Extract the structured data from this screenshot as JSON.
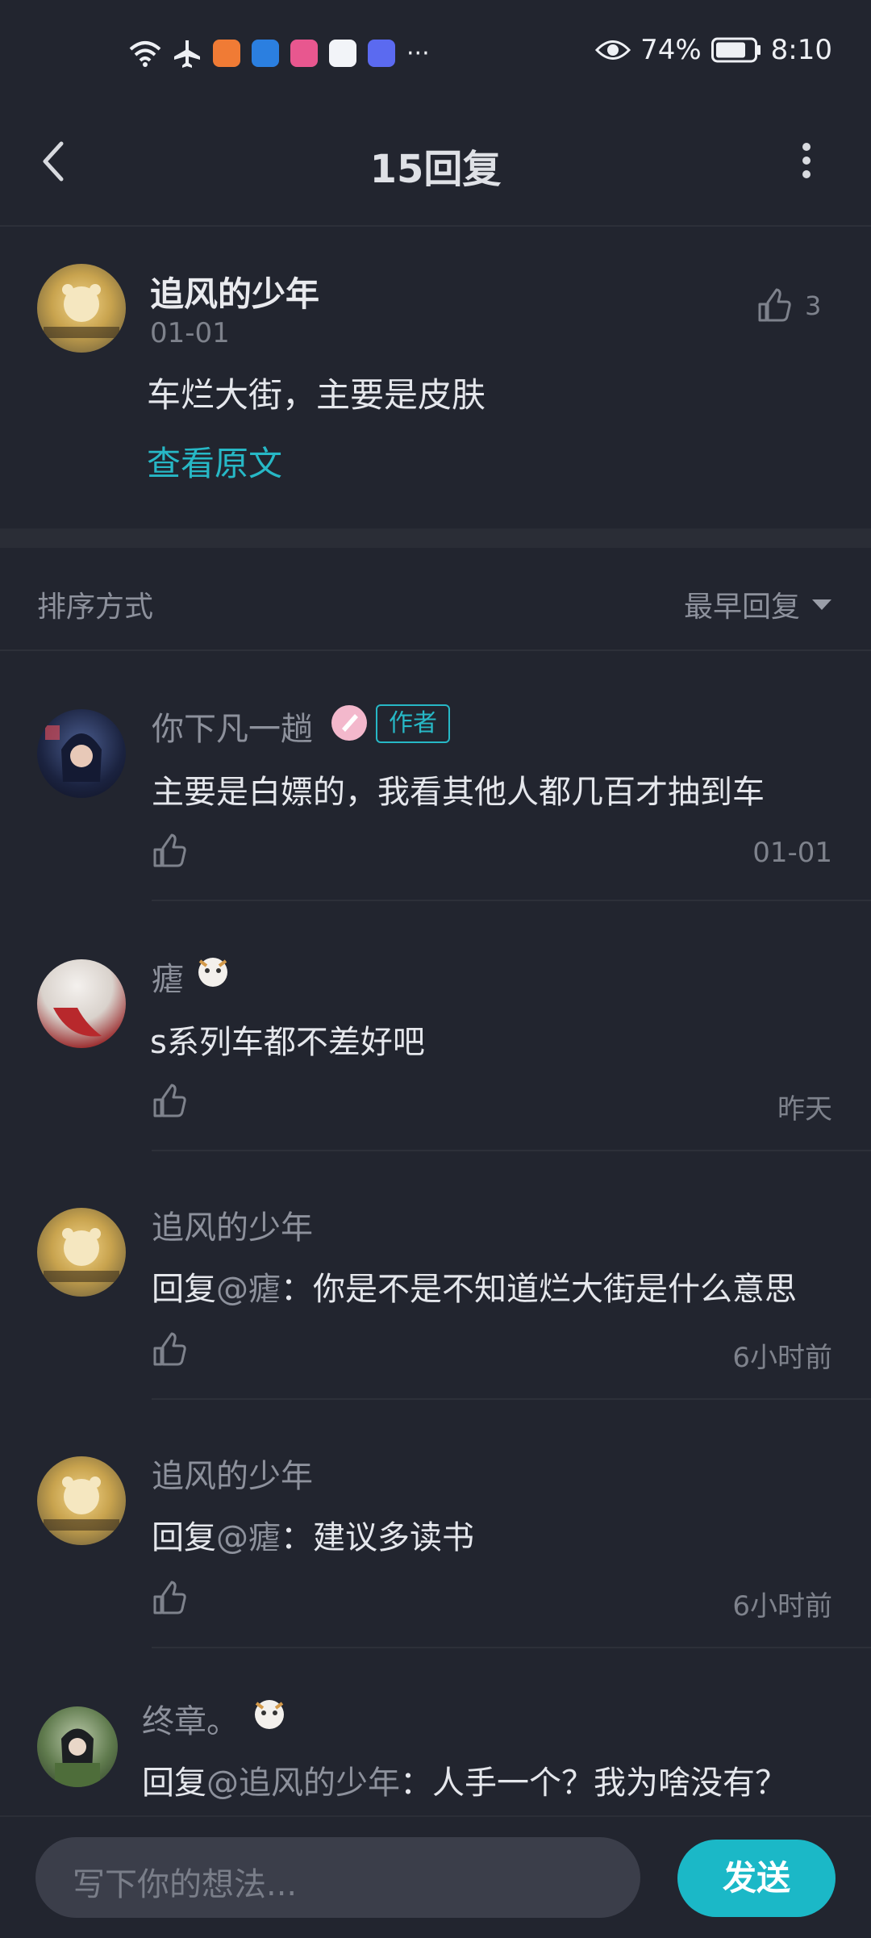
{
  "status_bar": {
    "battery": "74%",
    "time": "8:10",
    "more": "···"
  },
  "header": {
    "title": "15回复",
    "back_icon": "back-icon",
    "more_icon": "more-vertical-icon"
  },
  "main_comment": {
    "author": "追风的少年",
    "date": "01-01",
    "text": "车烂大街，主要是皮肤",
    "likes": "3",
    "view_original": "查看原文"
  },
  "sort": {
    "label": "排序方式",
    "value": "最早回复"
  },
  "replies": [
    {
      "author": "你下凡一趟",
      "badge": "作者",
      "text": "主要是白嫖的，我看其他人都几百才抽到车",
      "time": "01-01"
    },
    {
      "author": "瘧",
      "text": "s系列车都不差好吧",
      "time": "昨天"
    },
    {
      "author": "追风的少年",
      "reply_prefix": "回复",
      "mention": "@瘧",
      "text": "：你是不是不知道烂大街是什么意思",
      "time": "6小时前"
    },
    {
      "author": "追风的少年",
      "reply_prefix": "回复",
      "mention": "@瘧",
      "text": "：建议多读书",
      "time": "6小时前"
    },
    {
      "author": "终章。",
      "reply_prefix": "回复",
      "mention": "@追风的少年",
      "text": "：人手一个？我为啥没有？",
      "time": ""
    }
  ],
  "composer": {
    "placeholder": "写下你的想法...",
    "send": "发送"
  },
  "colors": {
    "background": "#22252f",
    "accent": "#1bb8c7",
    "link": "#27b8c6"
  }
}
